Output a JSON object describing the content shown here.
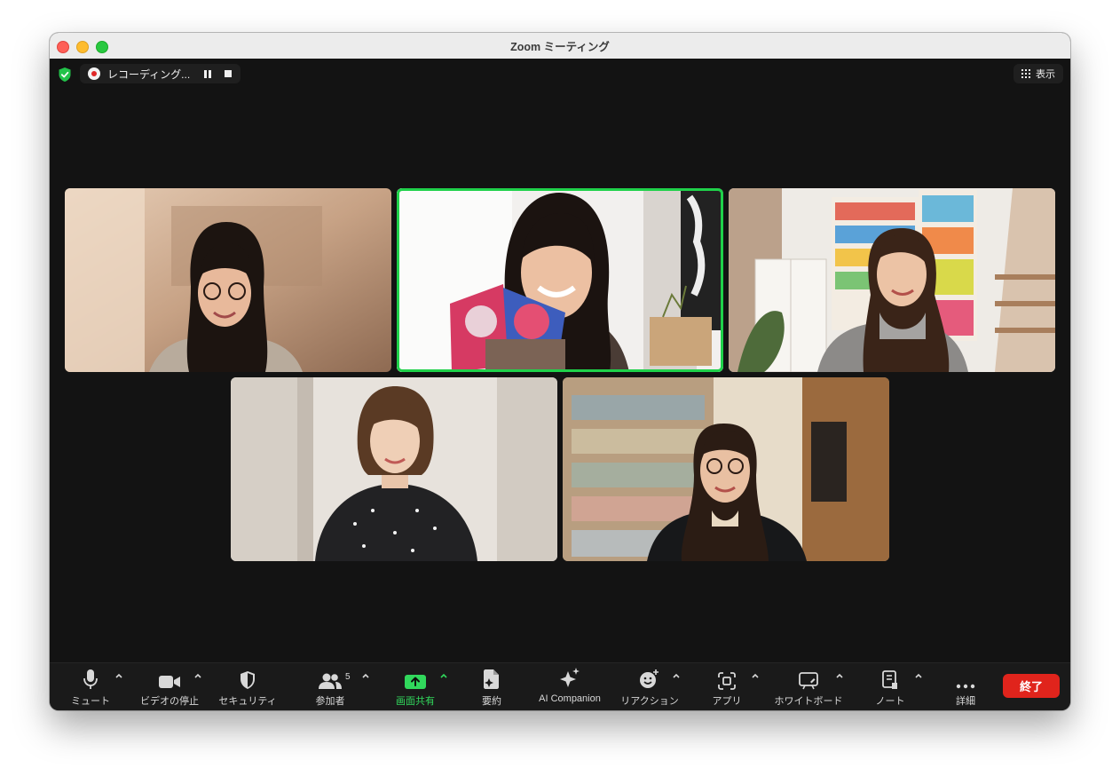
{
  "window": {
    "title": "Zoom ミーティング"
  },
  "recording": {
    "label": "レコーディング..."
  },
  "view": {
    "label": "表示"
  },
  "toolbar": {
    "mute_label": "ミュート",
    "video_label": "ビデオの停止",
    "security_label": "セキュリティ",
    "participants_label": "参加者",
    "participants_count": "5",
    "share_label": "画面共有",
    "summary_label": "要約",
    "ai_label": "AI Companion",
    "reaction_label": "リアクション",
    "apps_label": "アプリ",
    "whiteboard_label": "ホワイトボード",
    "notes_label": "ノート",
    "more_label": "詳細",
    "end_label": "終了"
  },
  "colors": {
    "accent_green": "#22d24b",
    "end_red": "#e0241c"
  }
}
